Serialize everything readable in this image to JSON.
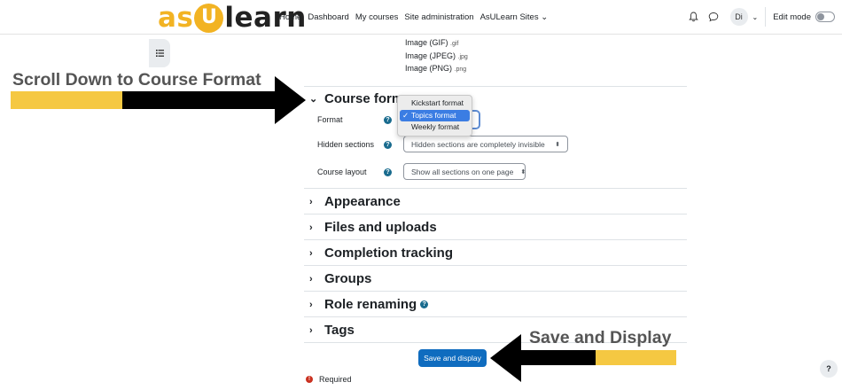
{
  "logo": {
    "part1": "as",
    "badge": "U",
    "part2": "learn"
  },
  "nav": {
    "links": [
      "Home",
      "Dashboard",
      "My courses",
      "Site administration",
      "AsULearn Sites ⌄"
    ],
    "avatar_initials": "Di",
    "edit_mode_label": "Edit mode"
  },
  "file_types": [
    {
      "name": "Image (GIF)",
      "ext": ".gif"
    },
    {
      "name": "Image (JPEG)",
      "ext": ".jpg"
    },
    {
      "name": "Image (PNG)",
      "ext": ".png"
    }
  ],
  "course_format": {
    "title": "Course form",
    "format_label": "Format",
    "format_options": [
      "Kickstart format",
      "Topics format",
      "Weekly format"
    ],
    "format_selected": "Topics format",
    "hidden_sections_label": "Hidden sections",
    "hidden_sections_value": "Hidden sections are completely invisible",
    "course_layout_label": "Course layout",
    "course_layout_value": "Show all sections on one page"
  },
  "sections": [
    "Appearance",
    "Files and uploads",
    "Completion tracking",
    "Groups",
    "Role renaming",
    "Tags"
  ],
  "save_button": "Save and display",
  "required_label": "Required",
  "annotations": {
    "top": "Scroll Down to Course Format",
    "bottom": "Save and Display"
  },
  "colors": {
    "brand_yellow": "#f2b323",
    "primary": "#0f6cbf",
    "help": "#196b8e",
    "callout_yellow": "#f5c842"
  },
  "icons": {
    "bell": "bell-icon",
    "chat": "chat-icon",
    "drawer": "course-index-icon",
    "help": "help-icon",
    "required": "required-icon",
    "float_help": "question-icon"
  }
}
